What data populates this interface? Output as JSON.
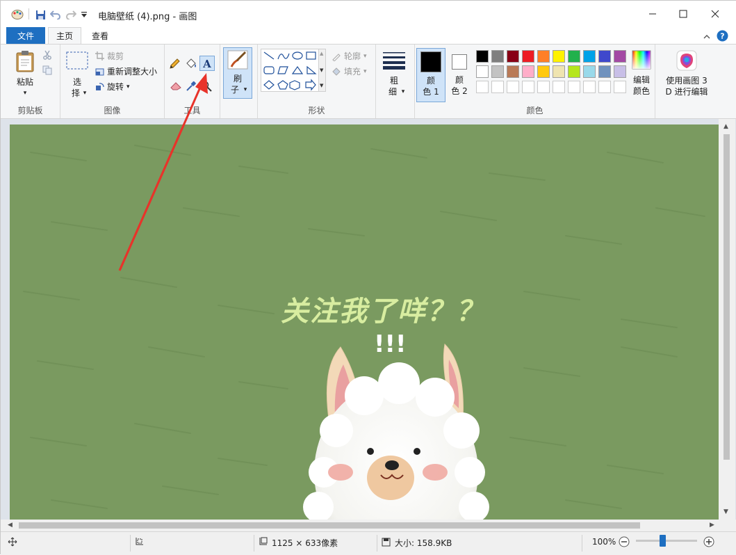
{
  "window": {
    "title": "电脑壁纸 (4).png - 画图"
  },
  "tabs": {
    "file": "文件",
    "home": "主页",
    "view": "查看"
  },
  "ribbon": {
    "clipboard": {
      "label": "剪贴板",
      "paste": "粘贴"
    },
    "image": {
      "label": "图像",
      "select_1": "选",
      "select_2": "择",
      "crop": "裁剪",
      "resize": "重新调整大小",
      "rotate": "旋转"
    },
    "tools": {
      "label": "工具"
    },
    "brushes": {
      "label_1": "刷",
      "label_2": "子"
    },
    "shapes": {
      "label": "形状",
      "outline": "轮廓",
      "fill": "填充"
    },
    "size": {
      "label_1": "粗",
      "label_2": "细"
    },
    "colors": {
      "label": "颜色",
      "color1_a": "颜",
      "color1_b": "色 1",
      "color2_a": "颜",
      "color2_b": "色 2",
      "edit_a": "编辑",
      "edit_b": "颜色",
      "palette_row1": [
        "#000000",
        "#7f7f7f",
        "#880015",
        "#ed1c24",
        "#ff7f27",
        "#fff200",
        "#22b14c",
        "#00a2e8",
        "#3f48cc",
        "#a349a4"
      ],
      "palette_row2": [
        "#ffffff",
        "#c3c3c3",
        "#b97a57",
        "#ffaec9",
        "#ffc90e",
        "#efe4b0",
        "#b5e61d",
        "#99d9ea",
        "#7092be",
        "#c8bfe7"
      ],
      "primary": "#000000",
      "secondary": "#ffffff"
    },
    "paint3d": {
      "line1": "使用画图 3",
      "line2": "D 进行编辑"
    }
  },
  "canvas": {
    "headline": "关注我了咩？？",
    "exclaim": "!!!",
    "background_color": "#7a9a60",
    "annotation_color": "#e8332a"
  },
  "status": {
    "dimensions": "1125 × 633像素",
    "size": "大小: 158.9KB",
    "zoom": "100%",
    "zoom_fraction": 0.43
  }
}
